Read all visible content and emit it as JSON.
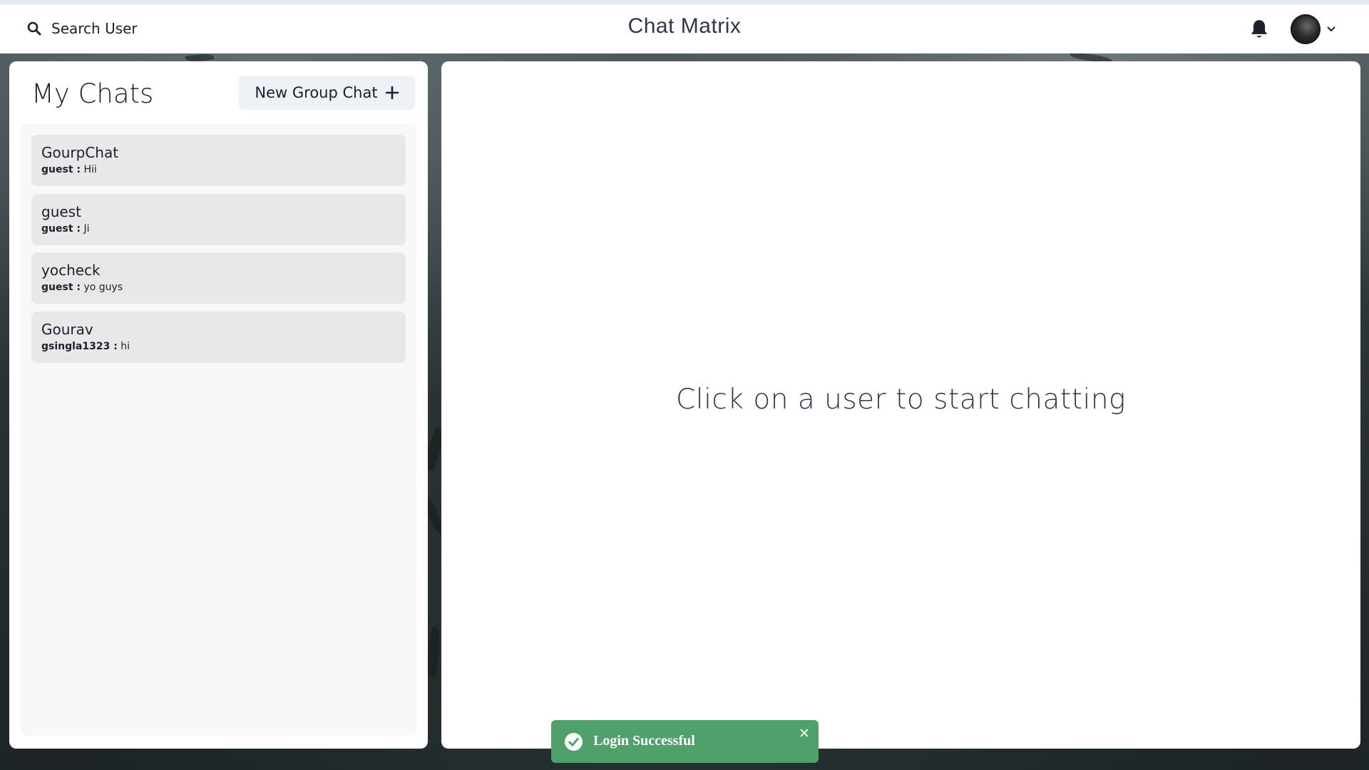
{
  "app": {
    "title": "Chat Matrix"
  },
  "header": {
    "search_label": "Search User",
    "icons": {
      "search": "search-icon",
      "notifications": "bell-icon",
      "profile_chevron": "chevron-down-icon"
    }
  },
  "sidebar": {
    "title": "My Chats",
    "new_group_label": "New Group Chat",
    "new_group_icon": "plus-icon",
    "chats": [
      {
        "name": "GourpChat",
        "sender": "guest :",
        "message": "Hii"
      },
      {
        "name": "guest",
        "sender": "guest :",
        "message": "Ji"
      },
      {
        "name": "yocheck",
        "sender": "guest :",
        "message": "yo guys"
      },
      {
        "name": "Gourav",
        "sender": "gsingla1323 :",
        "message": "hi"
      }
    ]
  },
  "main": {
    "empty_message": "Click on a user to start chatting"
  },
  "toast": {
    "message": "Login Successful",
    "status": "success",
    "color": "#4fa06b"
  }
}
